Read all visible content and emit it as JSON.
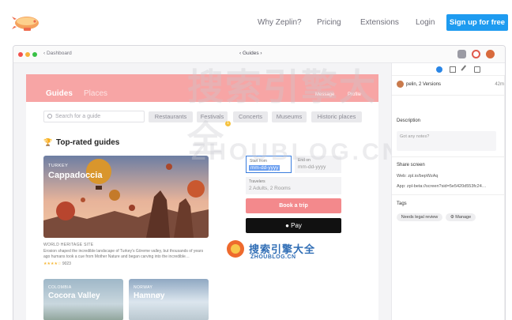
{
  "nav": {
    "links": [
      "Why Zeplin?",
      "Pricing",
      "Extensions",
      "Login"
    ],
    "signup": "Sign up for free"
  },
  "app": {
    "back": "‹  Dashboard",
    "breadcrumb": "‹      Guides      ›"
  },
  "screen": {
    "tab_guides": "Guides",
    "tab_places": "Places",
    "message": "Message",
    "profile": "Profile",
    "search_placeholder": "Search for a guide",
    "chips": [
      "Restaurants",
      "Festivals",
      "Concerts",
      "Museums",
      "Historic places"
    ],
    "badge": "1",
    "section_title": "Top-rated guides",
    "card": {
      "country": "TURKEY",
      "name": "Cappadoccia",
      "heritage": "WORLD HERITAGE SITE",
      "desc": "Erosion shaped the incredible landscape of Turkey's Göreme valley, but thousands of years ago humans took a cue from Mother Nature and began carving into the incredible…",
      "rating_count": "9023",
      "rating": 4
    },
    "thumbs": [
      {
        "country": "COLOMBIA",
        "name": "Cocora Valley"
      },
      {
        "country": "NORWAY",
        "name": "Hamnøy"
      }
    ],
    "form": {
      "start_label": "Start from",
      "start_value": "mm-dd-yyyy",
      "end_label": "End on",
      "end_value": "mm-dd-yyyy",
      "travel_label": "Travelers",
      "travel_value": "2 Adults, 2 Rooms",
      "book": "Book a trip",
      "pay": "Pay"
    }
  },
  "watermark": {
    "big_cn": "搜索引擎大全",
    "big_en": "ZHOUBLOG.CN",
    "small_cn": "搜索引擎大全",
    "small_en": "ZHOUBLOG.CN"
  },
  "inspector": {
    "author": "pelin, 2 Versions",
    "time": "42m",
    "description_label": "Description",
    "notes_placeholder": "Got any notes?",
    "share_label": "Share screen",
    "web_key": "Web:",
    "web_value": "zpl.io/bepWzAq",
    "app_key": "App:",
    "app_value": "zpl-beta://screen?sid=5e5420d553fc24…",
    "tags_label": "Tags",
    "tags": [
      "Needs legal review",
      "⚙ Manage"
    ]
  },
  "colors": {
    "brand_blue": "#1e9bf0",
    "header_pink": "#f7a5a5",
    "book_button": "#f3898c"
  }
}
